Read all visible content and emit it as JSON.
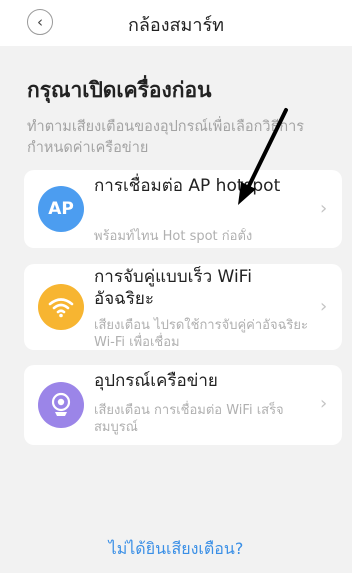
{
  "header": {
    "back_icon": "chevron-left-icon",
    "title": "กล้องสมาร์ท"
  },
  "heading": "กรุณาเปิดเครื่องก่อน",
  "subtext": "ทำตามเสียงเตือนของอุปกรณ์เพื่อเลือกวิธีการกำหนดค่าเครือข่าย",
  "options": [
    {
      "icon": "ap-badge-icon",
      "icon_text": "AP",
      "icon_color": "#4c9df0",
      "title": "การเชื่อมต่อ AP hotspot",
      "description": "พร้อมท์ไทน Hot spot ก่อตั้ง"
    },
    {
      "icon": "wifi-icon",
      "icon_color": "#f7b531",
      "title": "การจับคู่แบบเร็ว WiFi อัจฉริยะ",
      "description": "เสียงเตือน ไปรดใช้การจับคู่ค่าอัจฉริยะ Wi-Fi เพื่อเชื่อม"
    },
    {
      "icon": "router-icon",
      "icon_color": "#9b85e8",
      "title": "อุปกรณ์เครือข่าย",
      "description": "เสียงเตือน การเชื่อมต่อ WiFi เสร็จสมบูรณ์"
    }
  ],
  "footer_link": "ไม่ได้ยินเสียงเตือน?",
  "accent_color": "#3a8fe6"
}
